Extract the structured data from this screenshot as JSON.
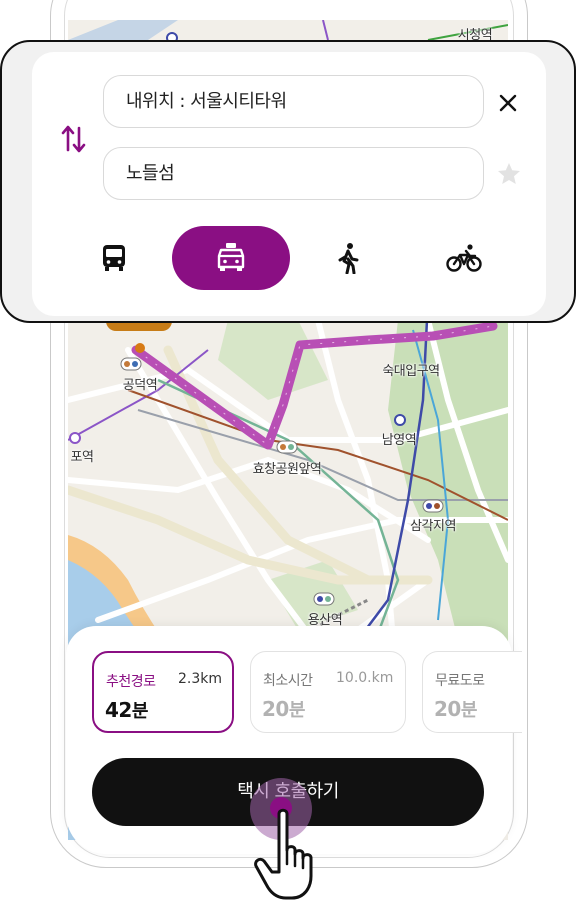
{
  "search": {
    "origin": "내위치 : 서울시티타워",
    "destination": "노들섬"
  },
  "icons": {
    "swap": "swap-arrows-icon",
    "close": "close-icon",
    "favorite": "star-icon",
    "bus": "bus-icon",
    "taxi": "taxi-icon",
    "walk": "walk-icon",
    "bike": "bicycle-icon",
    "cursor": "hand-pointer-icon"
  },
  "transport_modes": [
    {
      "id": "bus",
      "selected": false
    },
    {
      "id": "taxi",
      "selected": true
    },
    {
      "id": "walk",
      "selected": false
    },
    {
      "id": "bike",
      "selected": false
    }
  ],
  "map": {
    "stations": [
      {
        "name": "시청역"
      },
      {
        "name": "숙대입구역"
      },
      {
        "name": "공덕역"
      },
      {
        "name": "남영역"
      },
      {
        "name": "포역"
      },
      {
        "name": "효창공원앞역"
      },
      {
        "name": "삼각지역"
      },
      {
        "name": "용산역"
      }
    ]
  },
  "routes": [
    {
      "name": "추천경로",
      "distance": "2.3km",
      "time_num": "42",
      "time_unit": "분",
      "selected": true
    },
    {
      "name": "최소시간",
      "distance": "10.0.km",
      "time_num": "20",
      "time_unit": "분",
      "selected": false
    },
    {
      "name": "무료도로",
      "distance": "",
      "time_num": "20",
      "time_unit": "분",
      "selected": false
    }
  ],
  "call_button": "택시 호출하기",
  "colors": {
    "accent": "#8a0f83",
    "button": "#111111",
    "route_line": "#b84fb5",
    "pin": "#c77c17"
  }
}
